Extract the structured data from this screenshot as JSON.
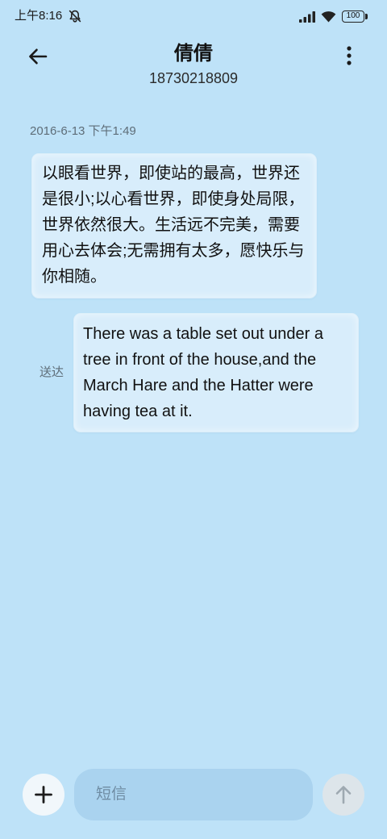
{
  "status_bar": {
    "time": "上午8:16",
    "battery_level": "100",
    "icons": [
      "mute-bell-icon",
      "signal-icon",
      "wifi-icon",
      "battery-icon"
    ]
  },
  "header": {
    "title": "倩倩",
    "subtitle": "18730218809",
    "back_icon": "back-arrow-icon",
    "menu_icon": "more-vertical-icon"
  },
  "conversation": {
    "timestamp": "2016-6-13 下午1:49",
    "received_message": {
      "lines": [
        "以眼看世界，即使站的最高，世界还",
        "是很小;以心看世界，即使身处局限，",
        "世界依然很大。生活远不完美，需要",
        "用心去体会;无需拥有太多，愿快乐与",
        "你相随。"
      ]
    },
    "sent_message": {
      "status": "送达",
      "lines": [
        "There was a table set out under a",
        "tree in front of the house,and the",
        "March Hare and the Hatter were",
        "having tea at it."
      ]
    }
  },
  "composer": {
    "placeholder": "短信",
    "add_icon": "plus-icon",
    "send_icon": "send-arrow-up-icon"
  },
  "colors": {
    "background": "#bee2f8",
    "bubble": "#d8edfb",
    "input": "#aad3ef",
    "text": "#111111",
    "muted": "#5e6d78"
  }
}
